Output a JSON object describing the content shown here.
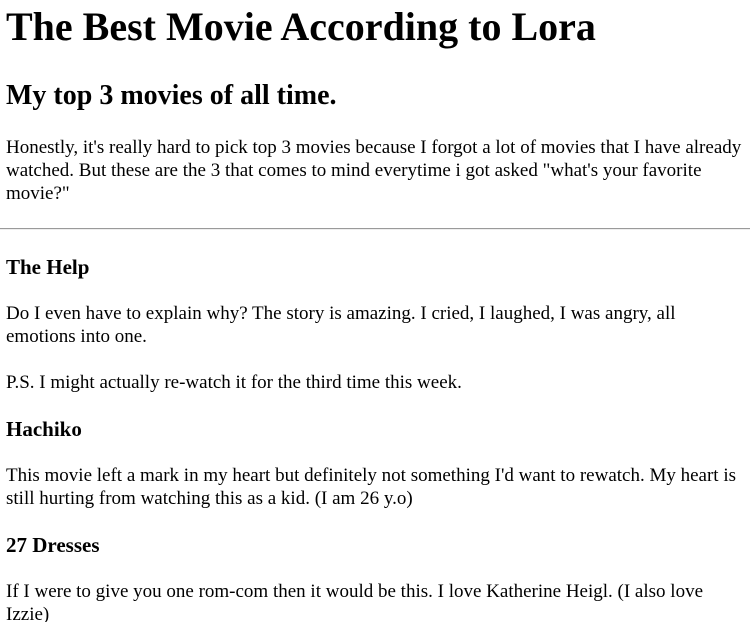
{
  "header": {
    "title": "The Best Movie According to Lora",
    "subtitle": "My top 3 movies of all time.",
    "intro": "Honestly, it's really hard to pick top 3 movies because I forgot a lot of movies that I have already watched. But these are the 3 that comes to mind everytime i got asked \"what's your favorite movie?\""
  },
  "movies": [
    {
      "title": "The Help",
      "paragraphs": [
        "Do I even have to explain why? The story is amazing. I cried, I laughed, I was angry, all emotions into one.",
        "P.S. I might actually re-watch it for the third time this week."
      ]
    },
    {
      "title": "Hachiko",
      "paragraphs": [
        "This movie left a mark in my heart but definitely not something I'd want to rewatch. My heart is still hurting from watching this as a kid. (I am 26 y.o)"
      ]
    },
    {
      "title": "27 Dresses",
      "paragraphs": [
        "If I were to give you one rom-com then it would be this. I love Katherine Heigl. (I also love Izzie)"
      ]
    }
  ]
}
